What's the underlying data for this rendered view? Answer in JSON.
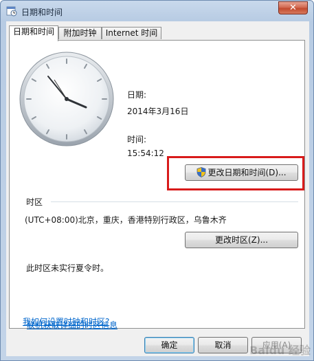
{
  "window": {
    "title": "日期和时间",
    "close_label": "✕"
  },
  "tabs": [
    {
      "label": "日期和时间",
      "active": true
    },
    {
      "label": "附加时钟",
      "active": false
    },
    {
      "label": "Internet 时间",
      "active": false
    }
  ],
  "date": {
    "label": "日期:",
    "value": "2014年3月16日"
  },
  "time": {
    "label": "时间:",
    "value": "15:54:12"
  },
  "change_datetime_button": "更改日期和时间(D)...",
  "timezone": {
    "section_label": "时区",
    "value": "(UTC+08:00)北京，重庆，香港特别行政区，乌鲁木齐",
    "change_button": "更改时区(Z)...",
    "dst_note": "此时区未实行夏令时。"
  },
  "links": {
    "online_info": "联机获取详细的时区信息",
    "how_to": "我如何设置时钟和时区?"
  },
  "footer": {
    "ok": "确定",
    "cancel": "取消",
    "apply": "应用(A)"
  },
  "watermark": "Baidu 经验",
  "colors": {
    "highlight_border": "#d81a1a",
    "link": "#0066cc",
    "default_button_border": "#3c7fb1"
  }
}
